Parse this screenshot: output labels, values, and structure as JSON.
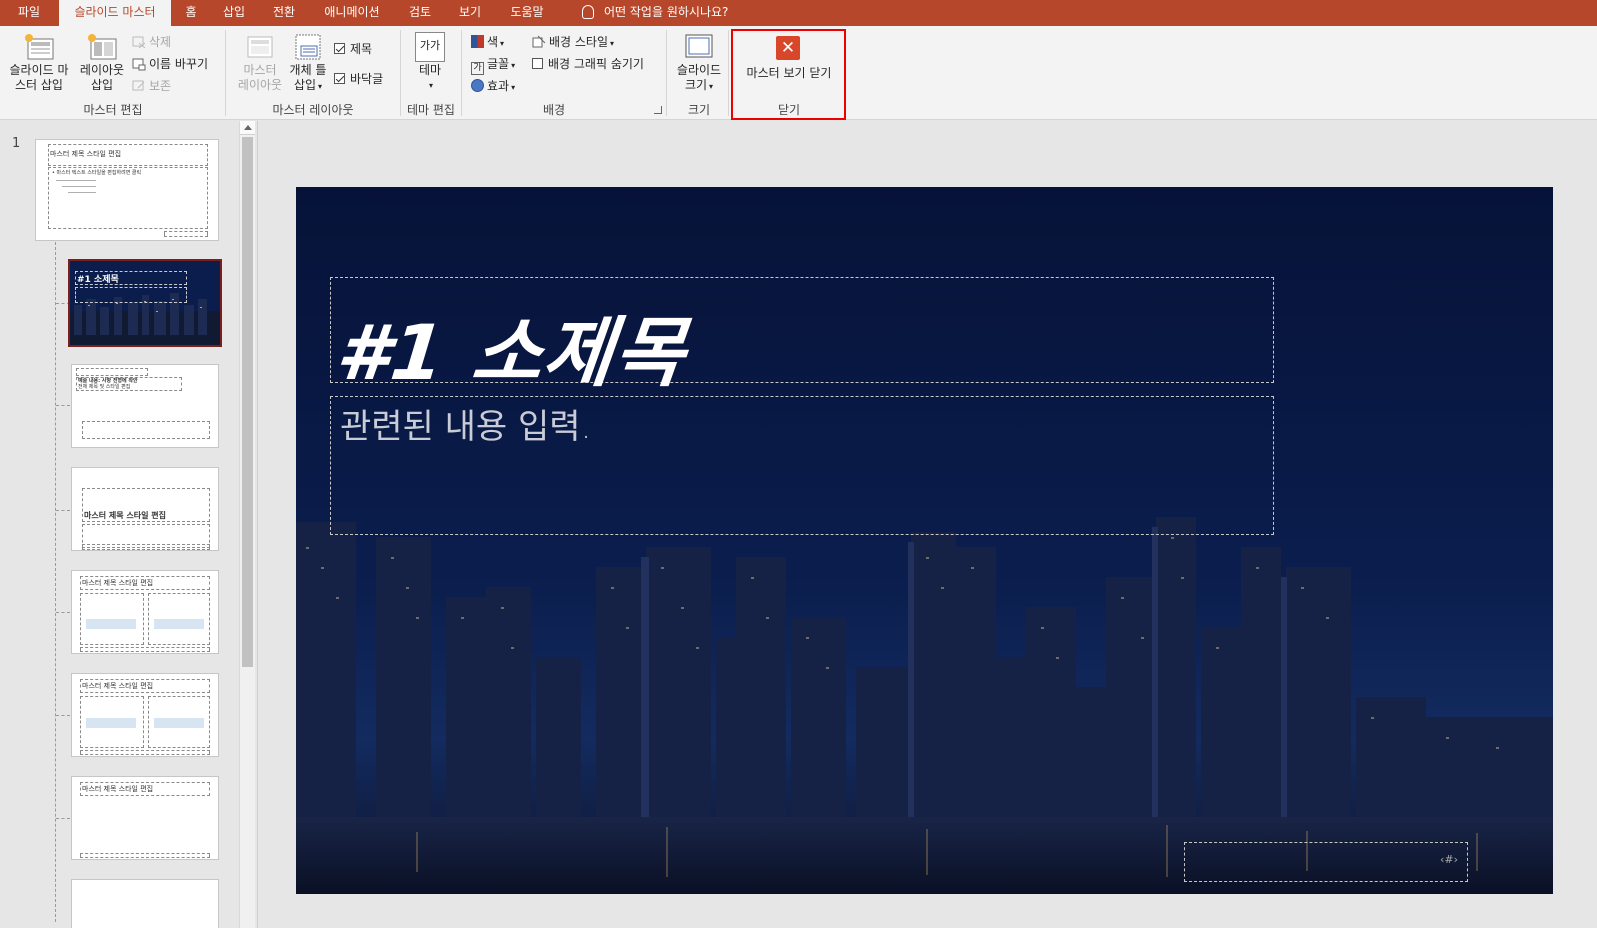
{
  "tabs": [
    {
      "label": "파일"
    },
    {
      "label": "슬라이드 마스터"
    },
    {
      "label": "홈"
    },
    {
      "label": "삽입"
    },
    {
      "label": "전환"
    },
    {
      "label": "애니메이션"
    },
    {
      "label": "검토"
    },
    {
      "label": "보기"
    },
    {
      "label": "도움말"
    }
  ],
  "tell_me": "어떤 작업을 원하시나요?",
  "ribbon": {
    "edit_master": {
      "label": "마스터 편집",
      "insert_master": "슬라이드 마\n스터 삽입",
      "insert_layout": "레이아웃\n삽입",
      "delete": "삭제",
      "rename": "이름 바꾸기",
      "preserve": "보존"
    },
    "master_layout": {
      "label": "마스터 레이아웃",
      "master_layout_btn": "마스터\n레이아웃",
      "insert_placeholder": "개체 틀\n삽입",
      "title_chk": "제목",
      "footer_chk": "바닥글"
    },
    "edit_theme": {
      "label": "테마 편집",
      "theme": "테마",
      "theme_icon_text": "가가"
    },
    "background": {
      "label": "배경",
      "colors": "색",
      "fonts": "글꼴",
      "effects": "효과",
      "bg_styles": "배경 스타일",
      "hide_bg": "배경 그래픽 숨기기"
    },
    "size": {
      "label": "크기",
      "slide_size": "슬라이드\n크기"
    },
    "close": {
      "label": "닫기",
      "close_master": "마스터 보기 닫기"
    }
  },
  "thumbnails": {
    "slide_number": "1",
    "master_title": "마스터 제목 스타일 편집",
    "master_text": "• 마스터 텍스트 스타일을 편집하려면 클릭",
    "t2_title": "#1 소제목",
    "t3_title": "예술 내용: 사항 전형에 착안",
    "t3_sub": "전체 제목 및 스타일 편집",
    "t4_title": "마스터 제목 스타일 편집",
    "t5_title": "마스터 제목 스타일 편집",
    "t6_title": "마스터 제목 스타일 편집",
    "t7_title": "마스터 제목 스타일 편집"
  },
  "slide": {
    "title": "#1 소제목",
    "subtitle": "관련된 내용 입력.",
    "footer_hash": "‹#›"
  },
  "colors": {
    "accent": "#b7472a",
    "highlight": "#ff0000",
    "slide_bg": "#0b1d4c"
  }
}
